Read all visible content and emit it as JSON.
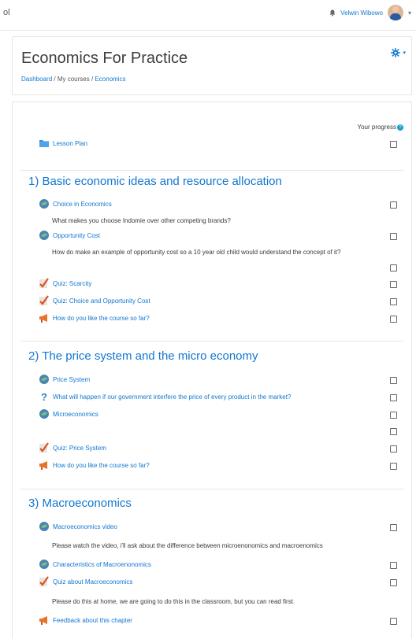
{
  "topbar": {
    "brand": "ol",
    "user_name": "Velwin Wibowo",
    "caret": "▾"
  },
  "header": {
    "title": "Economics For Practice",
    "breadcrumb": {
      "dashboard": "Dashboard",
      "sep1": "/",
      "my_courses": "My courses",
      "sep2": "/",
      "economics": "Economics"
    },
    "gear_caret": "▾"
  },
  "progress": {
    "label": "Your progress",
    "help": "?"
  },
  "intro": {
    "lesson_plan": "Lesson Plan"
  },
  "sections": [
    {
      "title": "1) Basic economic ideas and resource allocation",
      "items": [
        {
          "label": "Choice in Economics",
          "icon": "forum-icon"
        },
        {
          "desc": "What makes you choose Indomie over other competing brands?"
        },
        {
          "label": "Opportunity Cost",
          "icon": "forum-icon"
        },
        {
          "desc": "How do make an example of opportunity cost so a 10 year old child would understand the concept of it?"
        },
        {
          "label": "Quiz: Scarcity",
          "icon": "quiz-icon"
        },
        {
          "label": "Quiz: Choice and Opportunity Cost",
          "icon": "quiz-icon"
        },
        {
          "label": "How do you like the course so far?",
          "icon": "feedback-icon"
        }
      ]
    },
    {
      "title": "2) The price system and the micro economy",
      "items": [
        {
          "label": "Price System",
          "icon": "forum-icon"
        },
        {
          "label": "What will happen if our government interfere the price of every product in the market?",
          "icon": "question-icon"
        },
        {
          "label": "Microeconomics",
          "icon": "forum-icon"
        },
        {
          "label": "Quiz: Price System",
          "icon": "quiz-icon"
        },
        {
          "label": "How do you like the course so far?",
          "icon": "feedback-icon"
        }
      ]
    },
    {
      "title": "3) Macroeconomics",
      "items": [
        {
          "label": "Macroeconomics video",
          "icon": "forum-icon"
        },
        {
          "desc": "Please watch the video, i'll ask about the difference between microenonomics and macroenomics"
        },
        {
          "label": "Characteristics of Macroenonomics",
          "icon": "forum-icon"
        },
        {
          "label": "Quiz about Macroeconomics",
          "icon": "quiz-icon"
        },
        {
          "desc": "Please do this at home, we are going to do this in the classroom, but you can read first."
        },
        {
          "label": "Feedback about this chapter",
          "icon": "feedback-icon"
        }
      ]
    }
  ]
}
